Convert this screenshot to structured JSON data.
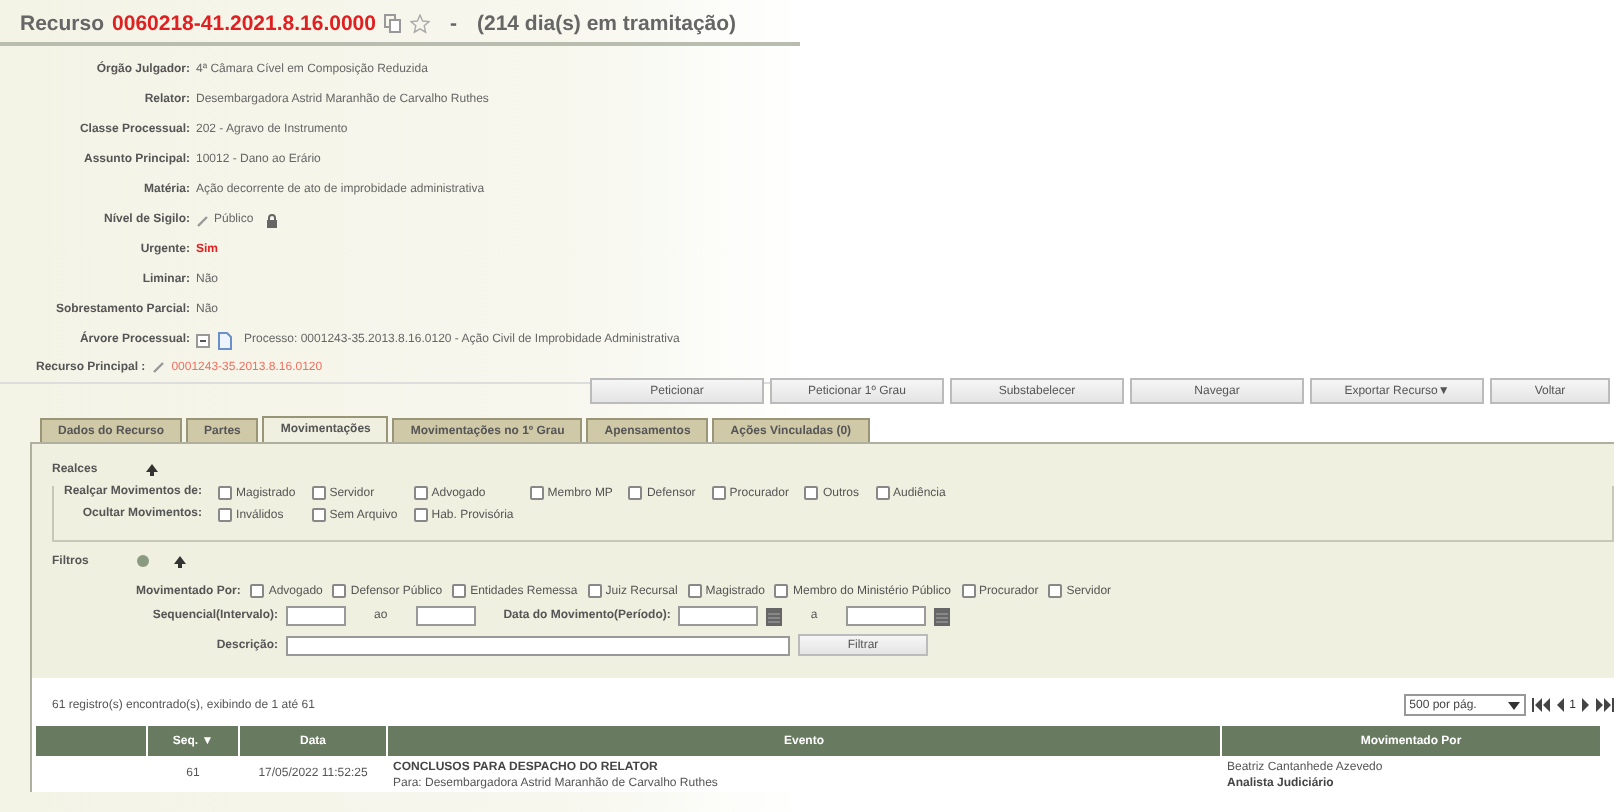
{
  "header": {
    "prefix": "Recurso",
    "number": "0060218-41.2021.8.16.0000",
    "separator": "-",
    "duration": "(214 dia(s) em tramitação)"
  },
  "fields": [
    {
      "kind": "text",
      "label": "Órgão Julgador:",
      "value": "4ª Câmara Cível em Composição Reduzida"
    },
    {
      "kind": "text",
      "label": "Relator:",
      "value": "Desembargadora Astrid Maranhão de Carvalho Ruthes"
    },
    {
      "kind": "text",
      "label": "Classe Processual:",
      "value": "202 - Agravo de Instrumento"
    },
    {
      "kind": "text",
      "label": "Assunto Principal:",
      "value": "10012 - Dano ao Erário"
    },
    {
      "kind": "text",
      "label": "Matéria:",
      "value": "Ação decorrente de ato de improbidade administrativa"
    },
    {
      "kind": "secrecy",
      "label": "Nível de Sigilo:",
      "value": "Público"
    },
    {
      "kind": "alert",
      "label": "Urgente:",
      "value": "Sim"
    },
    {
      "kind": "text",
      "label": "Liminar:",
      "value": "Não"
    },
    {
      "kind": "text",
      "label": "Sobrestamento Parcial:",
      "value": "Não"
    },
    {
      "kind": "tree",
      "label": "Árvore Processual:",
      "value": "Processo: 0001243-35.2013.8.16.0120 - Ação Civil de Improbidade Administrativa"
    }
  ],
  "main_appeal": {
    "label": "Recurso Principal :",
    "value": "0001243-35.2013.8.16.0120"
  },
  "buttons": [
    {
      "label": "Peticionar"
    },
    {
      "label": "Peticionar 1º Grau"
    },
    {
      "label": "Substabelecer"
    },
    {
      "label": "Navegar"
    },
    {
      "label": "Exportar Recurso▼"
    },
    {
      "label": "Voltar"
    }
  ],
  "tabs": [
    {
      "label": "Dados do Recurso",
      "selected": false
    },
    {
      "label": "Partes",
      "selected": false
    },
    {
      "label": "Movimentações",
      "selected": true
    },
    {
      "label": "Movimentações no 1º Grau",
      "selected": false
    },
    {
      "label": "Apensamentos",
      "selected": false
    },
    {
      "label": "Ações Vinculadas (0)",
      "selected": false
    }
  ],
  "highlights": {
    "legend": "Realces",
    "rows": [
      {
        "label": "Realçar Movimentos de:",
        "options": [
          {
            "label": "Magistrado",
            "checked": false
          },
          {
            "label": "Servidor",
            "checked": false
          },
          {
            "label": "Advogado",
            "checked": false
          },
          {
            "label": "Membro MP",
            "checked": false
          },
          {
            "label": "Defensor",
            "checked": false
          },
          {
            "label": "Procurador",
            "checked": false
          },
          {
            "label": "Outros",
            "checked": false
          },
          {
            "label": "Audiência",
            "checked": false
          }
        ]
      },
      {
        "label": "Ocultar Movimentos:",
        "options": [
          {
            "label": "Inválidos",
            "checked": false
          },
          {
            "label": "Sem Arquivo",
            "checked": false
          },
          {
            "label": "Hab. Provisória",
            "checked": false
          }
        ]
      }
    ]
  },
  "filters": {
    "legend": "Filtros",
    "moved_by_label": "Movimentado Por:",
    "moved_by": [
      {
        "label": "Advogado",
        "checked": false
      },
      {
        "label": "Defensor Público",
        "checked": false
      },
      {
        "label": "Entidades Remessa",
        "checked": false
      },
      {
        "label": "Juiz Recursal",
        "checked": false
      },
      {
        "label": "Magistrado",
        "checked": false
      },
      {
        "label": "Membro do Ministério Público",
        "checked": false
      },
      {
        "label": "Procurador",
        "checked": false
      },
      {
        "label": "Servidor",
        "checked": false
      }
    ],
    "sequence_label": "Sequencial(Intervalo):",
    "sequence_to": "ao",
    "date_label": "Data do Movimento(Período):",
    "date_to": "a",
    "description_label": "Descrição:",
    "filter_button": "Filtrar"
  },
  "records": "61 registro(s) encontrado(s), exibindo de 1 até 61",
  "pagination": {
    "per_page": "500 por pág.",
    "page": "1"
  },
  "table": {
    "columns": [
      "",
      "Seq. ▼",
      "Data",
      "Evento",
      "Movimentado Por"
    ],
    "rows": [
      {
        "seq": "61",
        "date": "17/05/2022 11:52:25",
        "event": "CONCLUSOS PARA DESPACHO DO RELATOR",
        "event_detail": "Para: Desembargadora Astrid Maranhão de Carvalho Ruthes",
        "moved_by": "Beatriz Cantanhede Azevedo",
        "moved_by_role": "Analista Judiciário"
      }
    ]
  }
}
